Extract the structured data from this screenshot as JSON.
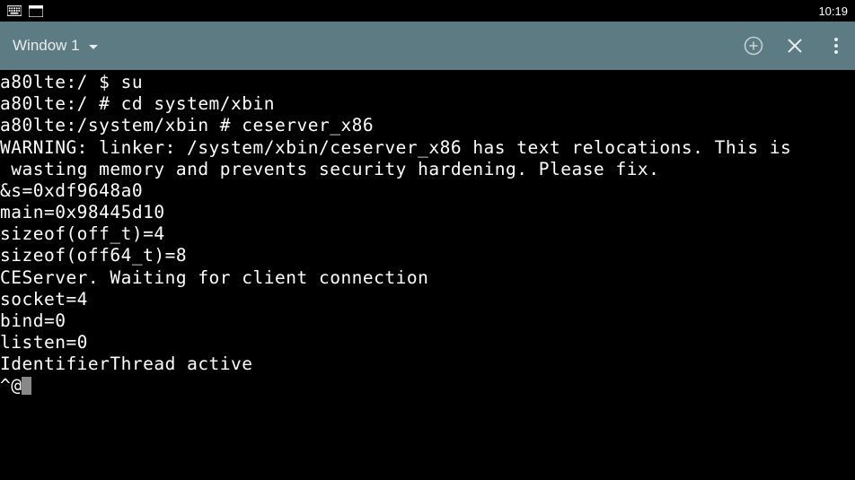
{
  "status_bar": {
    "time": "10:19"
  },
  "toolbar": {
    "window_label": "Window 1"
  },
  "terminal": {
    "lines": [
      "a80lte:/ $ su",
      "a80lte:/ # cd system/xbin",
      "a80lte:/system/xbin # ceserver_x86",
      "WARNING: linker: /system/xbin/ceserver_x86 has text relocations. This is",
      " wasting memory and prevents security hardening. Please fix.",
      "&s=0xdf9648a0",
      "main=0x98445d10",
      "sizeof(off_t)=4",
      "sizeof(off64_t)=8",
      "CEServer. Waiting for client connection",
      "socket=4",
      "bind=0",
      "listen=0",
      "IdentifierThread active"
    ],
    "last_line_prefix": "^@"
  }
}
